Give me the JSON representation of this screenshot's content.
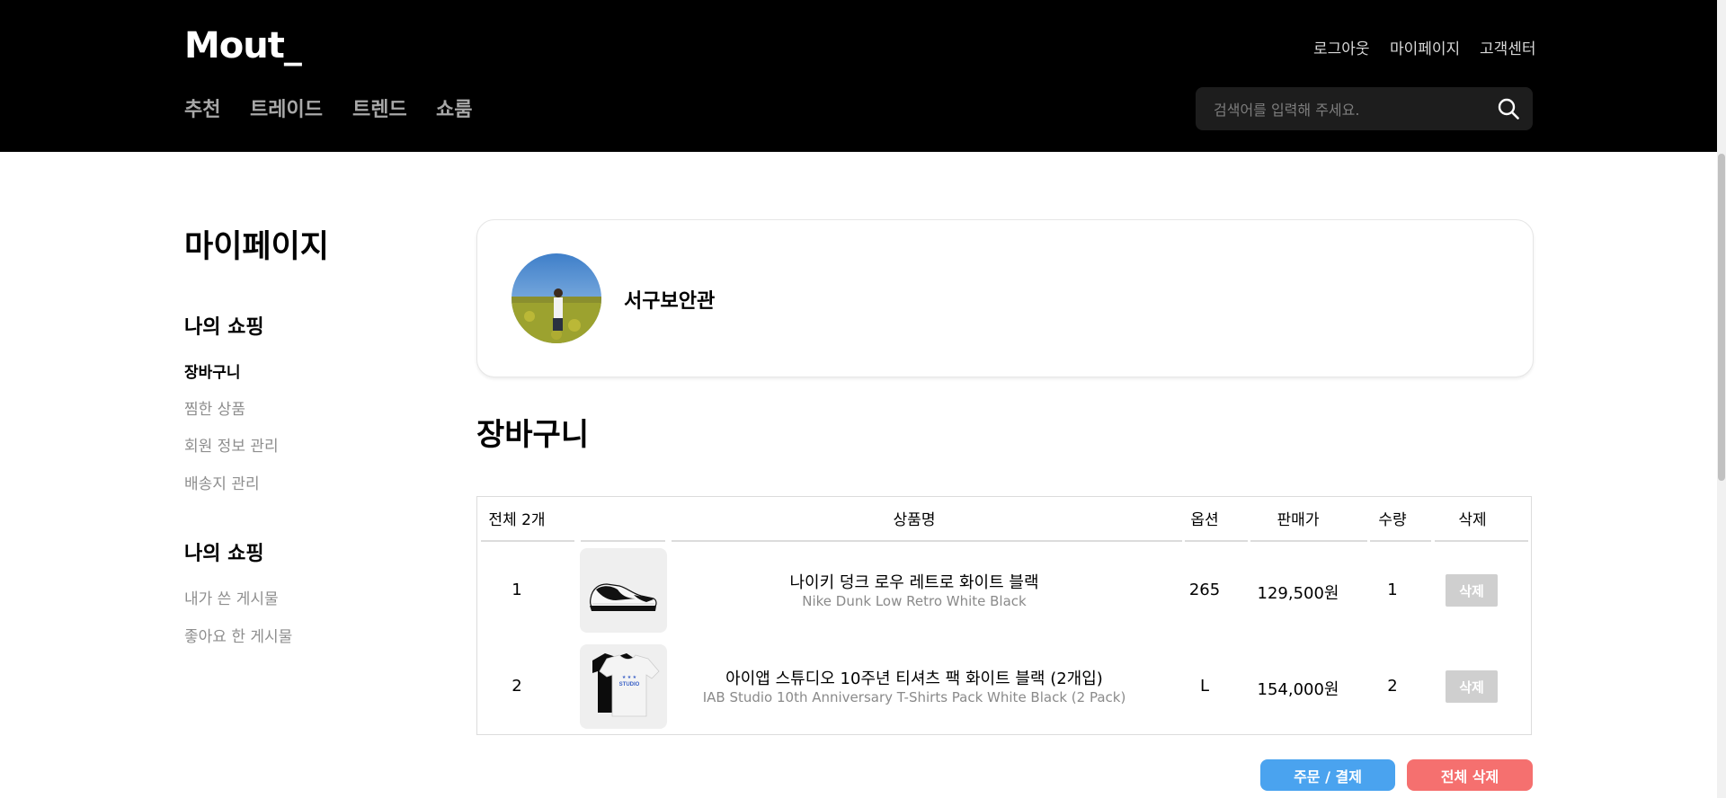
{
  "header": {
    "logo": "Mout_",
    "top_links": [
      "로그아웃",
      "마이페이지",
      "고객센터"
    ],
    "nav": [
      "추천",
      "트레이드",
      "트렌드",
      "쇼룸"
    ],
    "search_placeholder": "검색어를 입력해 주세요.",
    "search_icon": "search-icon"
  },
  "sidebar": {
    "title": "마이페이지",
    "section1_title": "나의 쇼핑",
    "section1_items": [
      "장바구니",
      "찜한 상품",
      "회원 정보 관리",
      "배송지 관리"
    ],
    "section2_title": "나의 쇼핑",
    "section2_items": [
      "내가 쓴 게시물",
      "좋아요 한 게시물"
    ]
  },
  "profile": {
    "name": "서구보안관"
  },
  "cart": {
    "title": "장바구니",
    "headers": {
      "total": "전체 2개",
      "name": "상품명",
      "option": "옵션",
      "price": "판매가",
      "qty": "수량",
      "delete": "삭제"
    },
    "items": [
      {
        "no": "1",
        "name_ko": "나이키 덩크 로우 레트로 화이트 블랙",
        "name_en": "Nike Dunk Low Retro White Black",
        "option": "265",
        "price": "129,500원",
        "qty": "1",
        "delete_label": "삭제"
      },
      {
        "no": "2",
        "name_ko": "아이앱 스튜디오 10주년 티셔츠 팩 화이트 블랙 (2개입)",
        "name_en": "IAB Studio 10th Anniversary T-Shirts Pack White Black (2 Pack)",
        "option": "L",
        "price": "154,000원",
        "qty": "2",
        "delete_label": "삭제"
      }
    ],
    "order_button": "주문 / 결제",
    "clear_button": "전체 삭제"
  },
  "colors": {
    "header_bg": "#000000",
    "order_button": "#4aa3ef",
    "clear_button": "#f5706f",
    "delete_button": "#cfcfcf"
  }
}
